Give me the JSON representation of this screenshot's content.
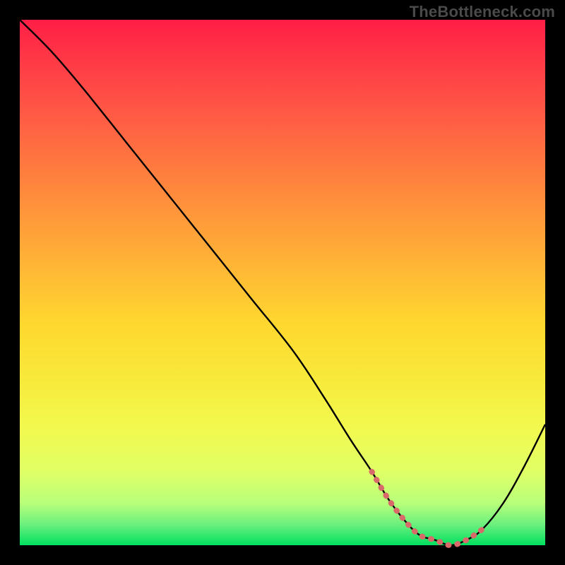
{
  "watermark": "TheBottleneck.com",
  "colors": {
    "frame_bg": "#000000",
    "watermark_text": "#4a4a4a",
    "curve_stroke": "#000000",
    "highlight_stroke": "#d96a6a",
    "gradient_top": "#ff1e46",
    "gradient_bottom": "#00e060"
  },
  "chart_data": {
    "type": "line",
    "title": "",
    "xlabel": "",
    "ylabel": "",
    "xlim": [
      0,
      100
    ],
    "ylim": [
      0,
      100
    ],
    "grid": false,
    "legend": false,
    "series": [
      {
        "name": "bottleneck-curve",
        "x": [
          0,
          6,
          12,
          20,
          28,
          36,
          44,
          52,
          58,
          63,
          67,
          70,
          73,
          76,
          79,
          82,
          85,
          88,
          92,
          96,
          100
        ],
        "y": [
          100,
          94,
          87,
          77,
          67,
          57,
          47,
          37,
          28,
          20,
          14,
          9,
          5,
          2,
          1,
          0,
          1,
          3,
          8,
          15,
          23
        ]
      },
      {
        "name": "highlight-segment",
        "x": [
          67,
          70,
          73,
          76,
          79,
          82,
          85,
          88
        ],
        "y": [
          14,
          9,
          5,
          2,
          1,
          0,
          1,
          3
        ]
      }
    ],
    "annotations": []
  }
}
